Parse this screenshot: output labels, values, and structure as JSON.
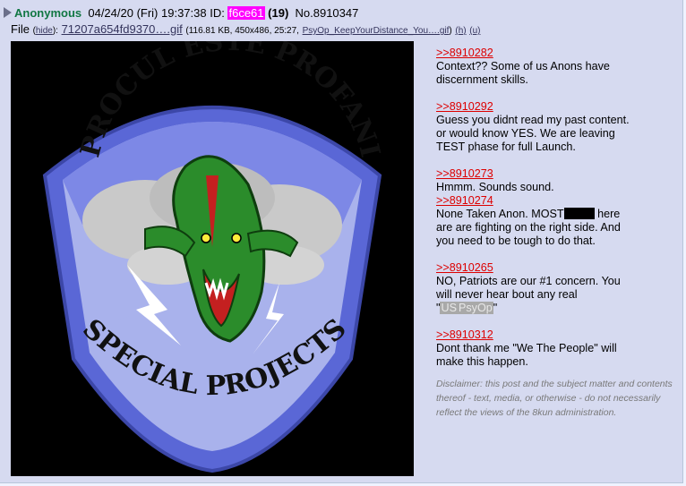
{
  "post": {
    "name": "Anonymous",
    "date": "04/24/20 (Fri) 19:37:38",
    "id_label": "ID:",
    "id_value": "f6ce61",
    "id_count": "(19)",
    "number": "No.8910347"
  },
  "file": {
    "label": "File",
    "hide": "hide",
    "filename": "71207a654fd9370….gif",
    "meta": "(116.81 KB, 450x486, 25:27,",
    "orig_name": "PsyOp_KeepYourDistance_You….gif",
    "h": "(h)",
    "u": "(u)"
  },
  "patch": {
    "top_text": "PROCUL ESTE PROFANI",
    "bottom_text": "SPECIAL PROJECTS",
    "colors": {
      "border": "#6b78e0",
      "sky": "#a9b2ec",
      "cloud": "#c9c9c9",
      "dragon": "#2b8c2b",
      "text": "#111111"
    }
  },
  "replies": [
    {
      "ref": ">>8910282",
      "lines": [
        "Context?? Some of us Anons have",
        "discernment skills."
      ]
    },
    {
      "ref": ">>8910292",
      "lines": [
        "Guess you didnt read my past content.",
        "or would know YES. We are leaving",
        "TEST phase for full Launch."
      ]
    },
    {
      "ref": ">>8910273",
      "lines": [
        "Hmmm. Sounds sound."
      ]
    },
    {
      "ref": ">>8910274",
      "pre": "None Taken Anon. MOST",
      "post": " here",
      "lines": [
        "are are fighting on the right side. And",
        "you need to be tough to do that."
      ]
    },
    {
      "ref": ">>8910265",
      "lines": [
        "NO, Patriots are our #1 concern. You",
        "will never hear bout any real"
      ],
      "q_open": "\"",
      "spoiler1": "US",
      "spoiler2": "PsyOp",
      "q_close": "\""
    },
    {
      "ref": ">>8910312",
      "lines": [
        "Dont thank me \"We The People\" will",
        "make this happen."
      ]
    }
  ],
  "disclaimer": "Disclaimer: this post and the subject matter and contents thereof - text, media, or otherwise - do not necessarily reflect the views of the 8kun administration."
}
